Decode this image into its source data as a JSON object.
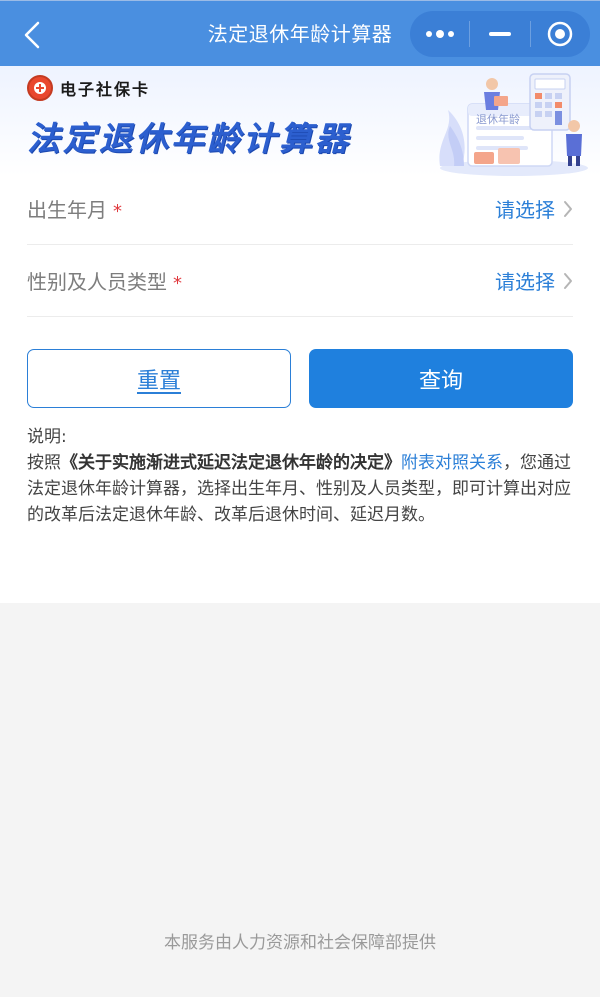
{
  "header": {
    "title": "法定退休年龄计算器"
  },
  "banner": {
    "brand": "电子社保卡",
    "title": "法定退休年龄计算器",
    "art_caption": "退休年龄"
  },
  "form": {
    "rows": [
      {
        "label": "出生年月",
        "required_mark": "*",
        "value": "请选择"
      },
      {
        "label": "性别及人员类型",
        "required_mark": "*",
        "value": "请选择"
      }
    ]
  },
  "buttons": {
    "reset": "重置",
    "query": "查询"
  },
  "note": {
    "heading": "说明:",
    "prefix": "按照",
    "doc_title": "《关于实施渐进式延迟法定退休年龄的决定》",
    "link": "附表对照关系",
    "body": "，您通过法定退休年龄计算器，选择出生年月、性别及人员类型，即可计算出对应的改革后法定退休年龄、改革后退休时间、延迟月数。"
  },
  "footer": {
    "text": "本服务由人力资源和社会保障部提供"
  },
  "colors": {
    "topbar": "#4a8fe0",
    "accent": "#2b7fd7",
    "query_button": "#1f80de",
    "required": "#e0393e"
  },
  "icons": {
    "back": "chevron-left-icon",
    "more": "more-dots-icon",
    "minimize": "minus-icon",
    "close": "target-circle-icon",
    "arrow": "chevron-right-icon",
    "logo": "social-security-logo-icon"
  }
}
